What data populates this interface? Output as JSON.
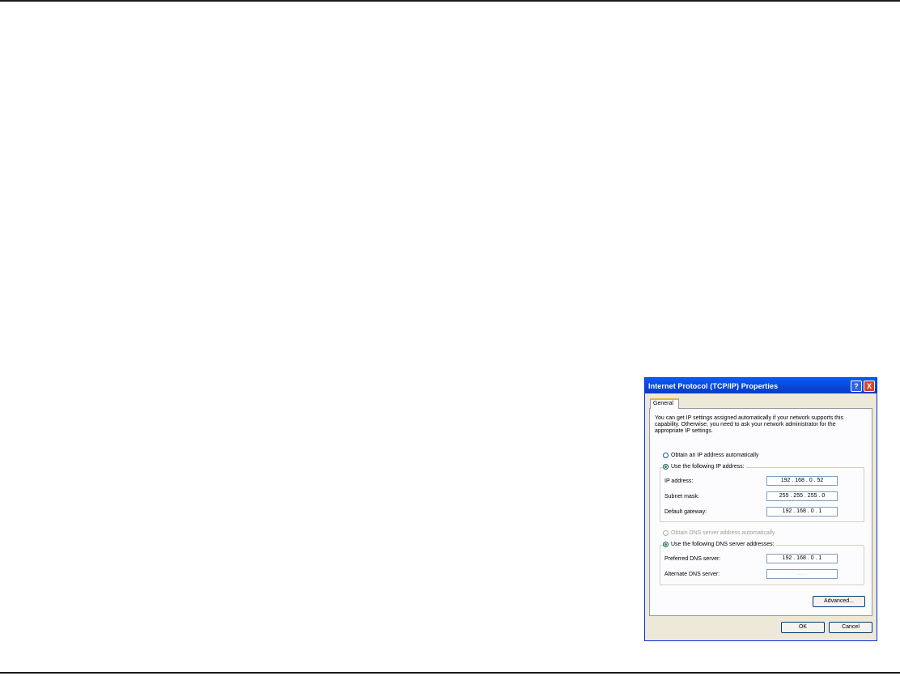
{
  "dialog": {
    "title": "Internet Protocol (TCP/IP) Properties",
    "help_symbol": "?",
    "close_symbol": "X",
    "tab_label": "General",
    "intro_text": "You can get IP settings assigned automatically if your network supports this capability. Otherwise, you need to ask your network administrator for the appropriate IP settings.",
    "ip_section": {
      "auto_label": "Obtain an IP address automatically",
      "manual_label": "Use the following IP address:",
      "selected": "manual",
      "fields": [
        {
          "label": "IP address:",
          "value": "192 . 168 .  0  . 52"
        },
        {
          "label": "Subnet mask:",
          "value": "255 . 255 . 255 .  0"
        },
        {
          "label": "Default gateway:",
          "value": "192 . 168 .  0  .  1"
        }
      ]
    },
    "dns_section": {
      "auto_label": "Obtain DNS server address automatically",
      "manual_label": "Use the following DNS server addresses:",
      "selected": "manual",
      "fields": [
        {
          "label": "Preferred DNS server:",
          "value": "192 . 168 .  0  .  1"
        },
        {
          "label": "Alternate DNS server:",
          "value": " .   .   . "
        }
      ]
    },
    "advanced_label": "Advanced...",
    "ok_label": "OK",
    "cancel_label": "Cancel"
  }
}
